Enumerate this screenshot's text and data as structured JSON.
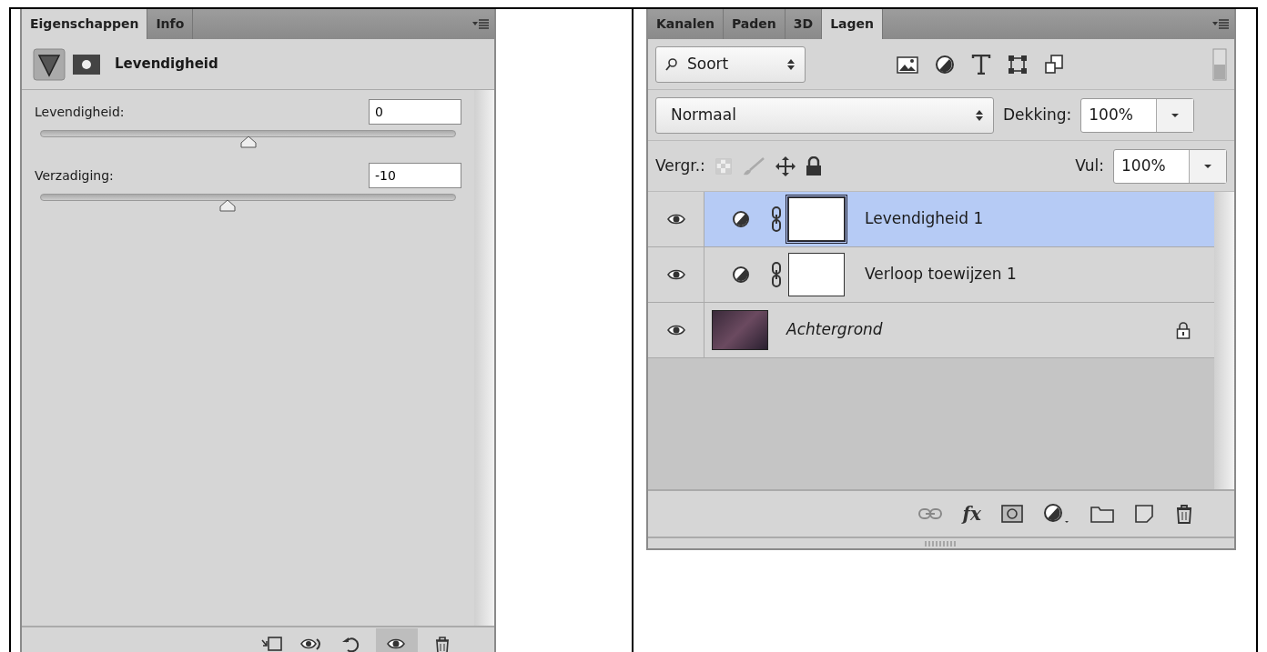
{
  "properties_panel": {
    "tabs": [
      {
        "label": "Eigenschappen",
        "selected": true
      },
      {
        "label": "Info",
        "selected": false
      }
    ],
    "title": "Levendigheid",
    "sliders": [
      {
        "label": "Levendigheid:",
        "value": "0",
        "level": 0.5
      },
      {
        "label": "Verzadiging:",
        "value": "-10",
        "level": 0.45
      }
    ],
    "footer_tools": [
      {
        "kind": "clip",
        "on": false
      },
      {
        "kind": "view-previous",
        "on": false
      },
      {
        "kind": "reset",
        "on": false
      },
      {
        "kind": "visibility",
        "on": true
      },
      {
        "kind": "delete",
        "on": false
      }
    ]
  },
  "layers_panel": {
    "tabs": [
      {
        "label": "Kanalen",
        "selected": false
      },
      {
        "label": "Paden",
        "selected": false
      },
      {
        "label": "3D",
        "selected": false
      },
      {
        "label": "Lagen",
        "selected": true
      }
    ],
    "filter": {
      "value": "Soort",
      "on": false
    },
    "blend_mode": {
      "value": "Normaal"
    },
    "opacity": {
      "label": "Dekking:",
      "value": "100%"
    },
    "lock_label": "Vergr.:",
    "fx_label": "fx",
    "fill": {
      "label": "Vul:",
      "value": "100%"
    },
    "layers": [
      {
        "kind": "adjustment",
        "name": "Levendigheid 1",
        "visible": true,
        "selected": true,
        "locked": false
      },
      {
        "kind": "adjustment",
        "name": "Verloop toewijzen 1",
        "visible": true,
        "selected": false,
        "locked": false
      },
      {
        "kind": "image",
        "name": "Achtergrond",
        "visible": true,
        "selected": false,
        "locked": true
      }
    ]
  }
}
